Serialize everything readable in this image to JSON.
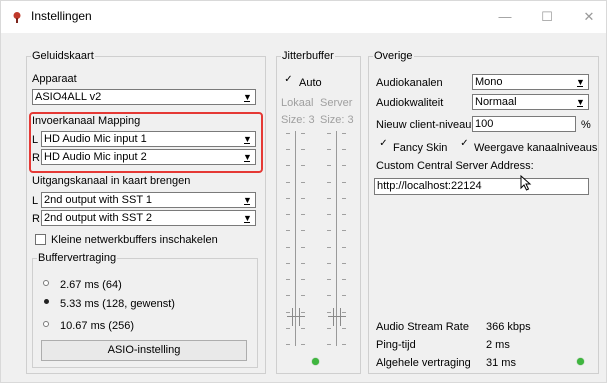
{
  "window": {
    "title": "Instellingen",
    "icon": "app-logo-icon",
    "controls": {
      "minimize": "—",
      "maximize": "☐",
      "close": "✕"
    }
  },
  "soundcard": {
    "legend": "Geluidskaart",
    "device_label": "Apparaat",
    "device_value": "ASIO4ALL v2",
    "input_mapping_label": "Invoerkanaal Mapping",
    "input_left_prefix": "L",
    "input_left_value": "HD Audio Mic input 1",
    "input_right_prefix": "R",
    "input_right_value": "HD Audio Mic input 2",
    "output_label": "Uitgangskanaal in kaart brengen",
    "output_left_prefix": "L",
    "output_left_value": "2nd output with SST 1",
    "output_right_prefix": "R",
    "output_right_value": "2nd output with SST 2",
    "small_buffers_label": "Kleine netwerkbuffers inschakelen",
    "small_buffers_checked": false,
    "buffer_delay": {
      "legend": "Buffervertraging",
      "options": [
        "2.67 ms (64)",
        "5.33 ms (128, gewenst)",
        "10.67 ms (256)"
      ],
      "selected_index": 1
    },
    "asio_button": "ASIO-instelling"
  },
  "jitterbuffer": {
    "legend": "Jitterbuffer",
    "auto_label": "Auto",
    "auto_checked": true,
    "auto_check_glyph": "✓",
    "local_label": "Lokaal",
    "server_label": "Server",
    "local_size": "Size: 3",
    "server_size": "Size: 3",
    "local_level": 0.1,
    "server_level": 0.1
  },
  "misc": {
    "legend": "Overige",
    "audio_channels_label": "Audiokanalen",
    "audio_channels_value": "Mono",
    "audio_quality_label": "Audiokwaliteit",
    "audio_quality_value": "Normaal",
    "client_level_label": "Nieuw client-niveau",
    "client_level_value": "100",
    "client_level_unit": "%",
    "fancy_skin_label": "Fancy Skin",
    "fancy_skin_checked": true,
    "channel_levels_label": "Weergave kanaalniveaus",
    "channel_levels_checked": true,
    "custom_server_label": "Custom Central Server Address:",
    "custom_server_value": "http://localhost:22124",
    "stream_rate_label": "Audio Stream Rate",
    "stream_rate_value": "366 kbps",
    "ping_label": "Ping-tijd",
    "ping_value": "2 ms",
    "delay_label": "Algehele vertraging",
    "delay_value": "31 ms"
  },
  "colors": {
    "highlight": "#e53935",
    "led": "#3fb63f"
  }
}
